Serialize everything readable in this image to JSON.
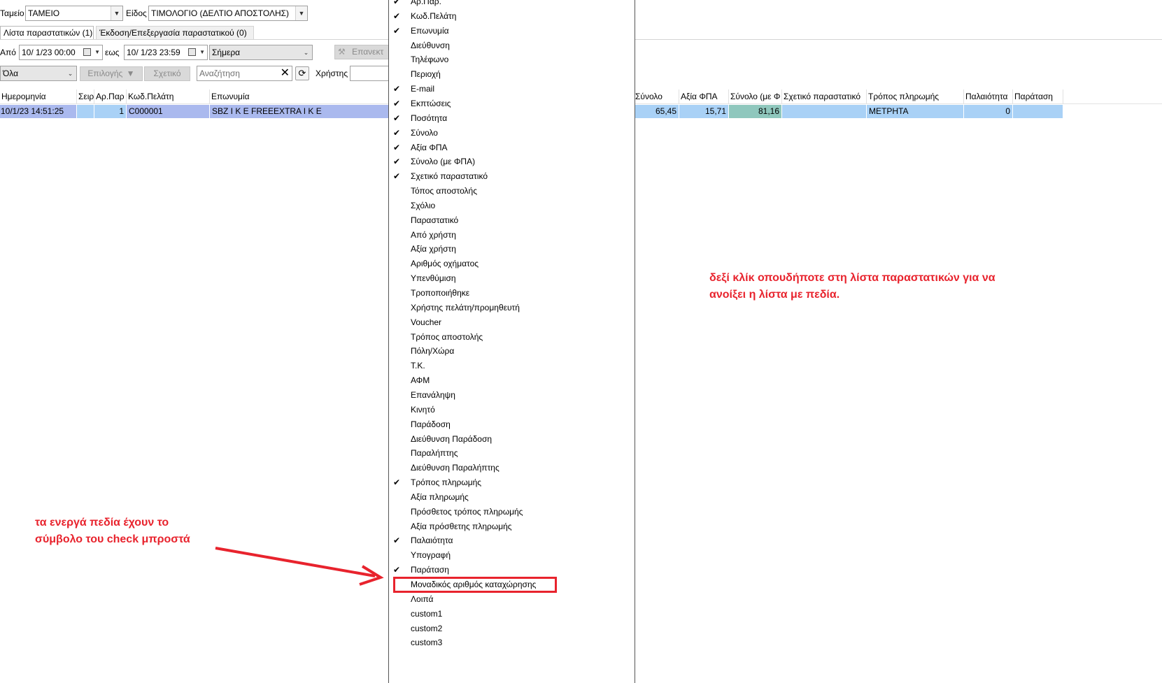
{
  "toolbar": {
    "tameio_label": "Ταμείο",
    "tameio_value": "ΤΑΜΕΙΟ",
    "eidos_label": "Είδος",
    "eidos_value": "ΤΙΜΟΛΟΓΙΟ (ΔΕΛΤΙΟ ΑΠΟΣΤΟΛΗΣ)"
  },
  "tabs": [
    {
      "label": "Λίστα παραστατικών (1)",
      "active": true
    },
    {
      "label": "Έκδοση/Επεξεργασία παραστατικού (0)",
      "active": false
    }
  ],
  "date_filter": {
    "from_label": "Από",
    "from_value": "10/  1/23 00:00",
    "to_label": "εως",
    "to_value": "10/  1/23 23:59",
    "period_value": "Σήμερα",
    "repeat_button": "Επανεκτ"
  },
  "filter_bar": {
    "status_value": "Όλα",
    "options_button": "Επιλογής",
    "related_button": "Σχετικό",
    "search_placeholder": "Αναζήτηση",
    "user_label": "Χρήστης",
    "user_value": ""
  },
  "grid": {
    "columns_left": [
      "Ημερομηνία",
      "Σειρ",
      "Αρ.Παρ",
      "Κωδ.Πελάτη",
      "Επωνυμία"
    ],
    "columns_right": [
      "Σύνολο",
      "Αξία ΦΠΑ",
      "Σύνολο (με Φ",
      "Σχετικό παραστατικό",
      "Τρόπος πληρωμής",
      "Παλαιότητα",
      "Παράταση"
    ],
    "row": {
      "date": "10/1/23 14:51:25",
      "series": "",
      "doc_no": "1",
      "customer_code": "C000001",
      "name": "SBZ I K E  FREEEXTRA I K E",
      "total": "65,45",
      "vat": "15,71",
      "total_vat": "81,16",
      "related_doc": "",
      "payment": "ΜΕΤΡΗΤΑ",
      "age": "0",
      "extension": ""
    }
  },
  "context_menu": {
    "check_glyph": "✔",
    "items": [
      {
        "label": "Αρ.Παρ.",
        "checked": true
      },
      {
        "label": "Κωδ.Πελάτη",
        "checked": true
      },
      {
        "label": "Επωνυμία",
        "checked": true
      },
      {
        "label": "Διεύθυνση",
        "checked": false
      },
      {
        "label": "Τηλέφωνο",
        "checked": false
      },
      {
        "label": "Περιοχή",
        "checked": false
      },
      {
        "label": "E-mail",
        "checked": true
      },
      {
        "label": "Εκπτώσεις",
        "checked": true
      },
      {
        "label": "Ποσότητα",
        "checked": true
      },
      {
        "label": "Σύνολο",
        "checked": true
      },
      {
        "label": "Αξία ΦΠΑ",
        "checked": true
      },
      {
        "label": "Σύνολο (με ΦΠΑ)",
        "checked": true
      },
      {
        "label": "Σχετικό παραστατικό",
        "checked": true
      },
      {
        "label": "Τόπος αποστολής",
        "checked": false
      },
      {
        "label": "Σχόλιο",
        "checked": false
      },
      {
        "label": "Παραστατικό",
        "checked": false
      },
      {
        "label": "Από χρήστη",
        "checked": false
      },
      {
        "label": "Αξία χρήστη",
        "checked": false
      },
      {
        "label": "Αριθμός οχήματος",
        "checked": false
      },
      {
        "label": "Υπενθύμιση",
        "checked": false
      },
      {
        "label": "Τροποποιήθηκε",
        "checked": false
      },
      {
        "label": "Χρήστης πελάτη/προμηθευτή",
        "checked": false
      },
      {
        "label": "Voucher",
        "checked": false
      },
      {
        "label": "Τρόπος αποστολής",
        "checked": false
      },
      {
        "label": "Πόλη/Χώρα",
        "checked": false
      },
      {
        "label": "Τ.Κ.",
        "checked": false
      },
      {
        "label": "ΑΦΜ",
        "checked": false
      },
      {
        "label": "Επανάληψη",
        "checked": false
      },
      {
        "label": "Κινητό",
        "checked": false
      },
      {
        "label": "Παράδοση",
        "checked": false
      },
      {
        "label": "Διεύθυνση Παράδοση",
        "checked": false
      },
      {
        "label": "Παραλήπτης",
        "checked": false
      },
      {
        "label": "Διεύθυνση Παραλήπτης",
        "checked": false
      },
      {
        "label": "Τρόπος πληρωμής",
        "checked": true
      },
      {
        "label": "Αξία πληρωμής",
        "checked": false
      },
      {
        "label": "Πρόσθετος τρόπος πληρωμής",
        "checked": false
      },
      {
        "label": "Αξία πρόσθετης πληρωμής",
        "checked": false
      },
      {
        "label": "Παλαιότητα",
        "checked": true
      },
      {
        "label": "Υπογραφή",
        "checked": false
      },
      {
        "label": "Παράταση",
        "checked": true
      },
      {
        "label": "Μοναδικός αριθμός καταχώρησης",
        "checked": false,
        "highlighted": true
      },
      {
        "label": "Λοιπά",
        "checked": false
      },
      {
        "label": "custom1",
        "checked": false
      },
      {
        "label": "custom2",
        "checked": false
      },
      {
        "label": "custom3",
        "checked": false
      }
    ]
  },
  "annotations": {
    "right_note_line1": "δεξί κλίκ οπουδήποτε στη λίστα παραστατικών για να",
    "right_note_line2": "ανοίξει η λίστα με πεδία.",
    "left_note_line1": "τα ενεργά πεδία έχουν το",
    "left_note_line2": "σύμβολο του check μπροστά",
    "accent_color": "#e8232d"
  }
}
